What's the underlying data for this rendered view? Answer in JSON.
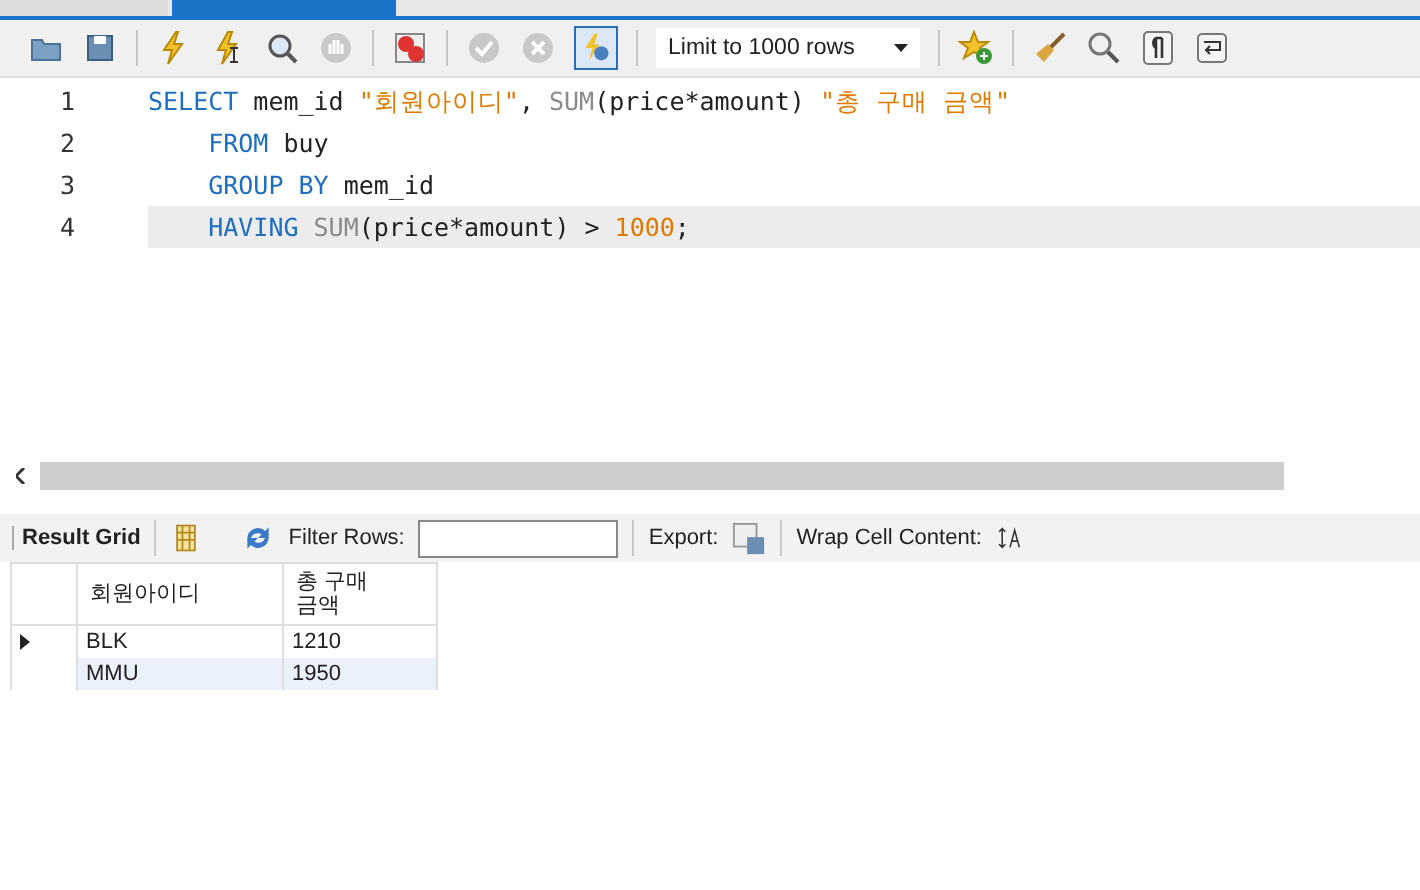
{
  "tabs": [
    {
      "selected": false
    },
    {
      "selected": true
    }
  ],
  "toolbar": {
    "limit": "Limit to 1000 rows",
    "toggle_on": true
  },
  "editor": {
    "lines": [
      {
        "number": "1",
        "current": false,
        "tokens": [
          {
            "kind": "keyword",
            "text": "SELECT"
          },
          {
            "kind": "plain",
            "text": " mem_id "
          },
          {
            "kind": "string",
            "text": "\"회원아이디\""
          },
          {
            "kind": "plain",
            "text": ", "
          },
          {
            "kind": "func",
            "text": "SUM"
          },
          {
            "kind": "plain",
            "text": "(price*amount) "
          },
          {
            "kind": "string",
            "text": "\"총 구매 금액\""
          }
        ]
      },
      {
        "number": "2",
        "current": false,
        "indent": true,
        "tokens": [
          {
            "kind": "keyword",
            "text": "FROM"
          },
          {
            "kind": "plain",
            "text": " buy"
          }
        ]
      },
      {
        "number": "3",
        "current": false,
        "indent": true,
        "tokens": [
          {
            "kind": "keyword",
            "text": "GROUP BY"
          },
          {
            "kind": "plain",
            "text": " mem_id"
          }
        ]
      },
      {
        "number": "4",
        "current": true,
        "indent": true,
        "tokens": [
          {
            "kind": "keyword",
            "text": "HAVING "
          },
          {
            "kind": "func",
            "text": "SUM"
          },
          {
            "kind": "plain",
            "text": "(price*amount) > "
          },
          {
            "kind": "number",
            "text": "1000"
          },
          {
            "kind": "plain",
            "text": ";"
          }
        ]
      }
    ]
  },
  "results": {
    "result_grid": "Result Grid",
    "filter_label": "Filter Rows:",
    "export_label": "Export:",
    "wrap_label": "Wrap Cell Content:",
    "columns": [
      "회원아이디",
      "총 구매\n금액"
    ],
    "rows": [
      {
        "selected": true,
        "cells": [
          "BLK",
          "1210"
        ]
      },
      {
        "selected": false,
        "cells": [
          "MMU",
          "1950"
        ]
      }
    ]
  }
}
